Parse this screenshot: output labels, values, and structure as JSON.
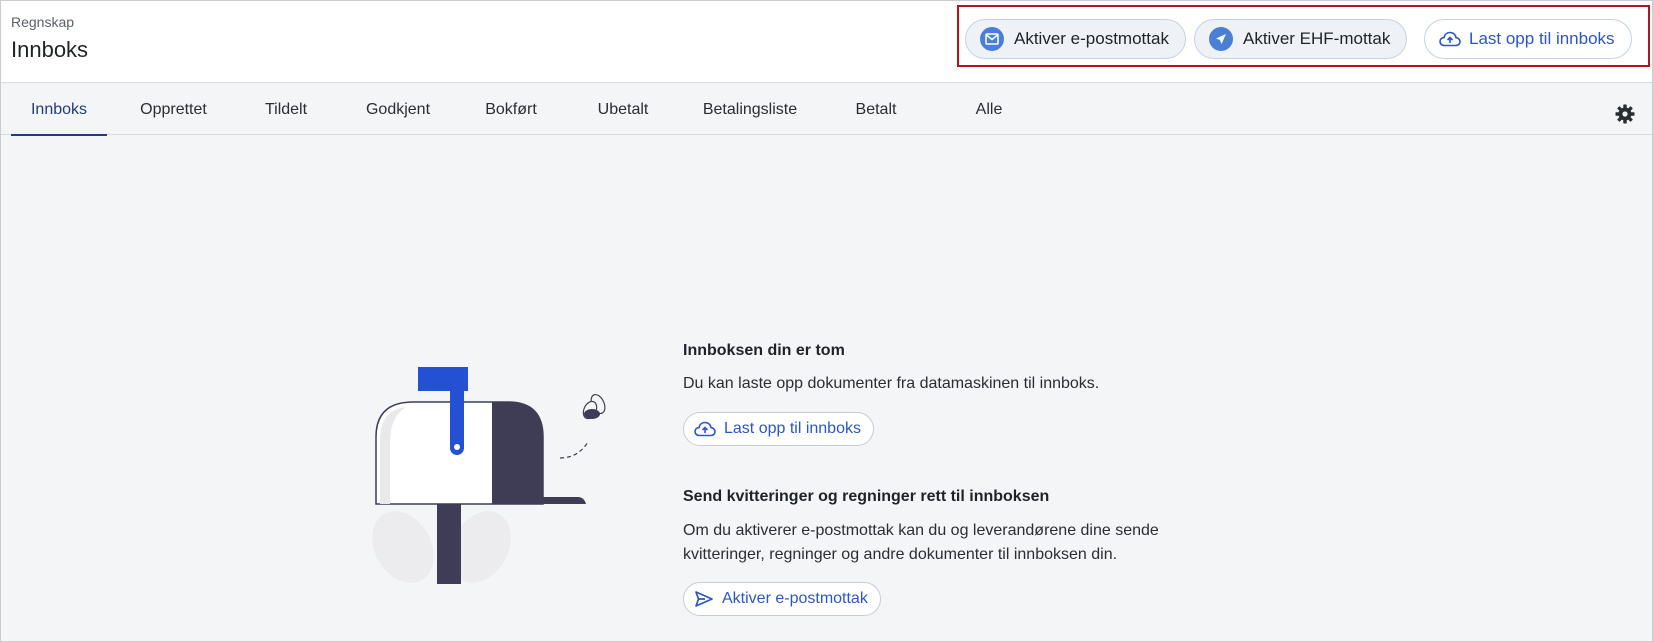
{
  "header": {
    "breadcrumb": "Regnskap",
    "title": "Innboks",
    "actions": {
      "email_label": "Aktiver e-postmottak",
      "ehf_label": "Aktiver EHF-mottak",
      "upload_label": "Last opp til innboks"
    }
  },
  "tabs": [
    {
      "label": "Innboks",
      "active": true
    },
    {
      "label": "Opprettet"
    },
    {
      "label": "Tildelt"
    },
    {
      "label": "Godkjent"
    },
    {
      "label": "Bokført"
    },
    {
      "label": "Ubetalt"
    },
    {
      "label": "Betalingsliste"
    },
    {
      "label": "Betalt"
    },
    {
      "label": "Alle"
    }
  ],
  "empty_state": {
    "title": "Innboksen din er tom",
    "text": "Du kan laste opp dokumenter fra datamaskinen til innboks.",
    "upload_label": "Last opp til innboks",
    "send_title": "Send kvitteringer og regninger rett til innboksen",
    "send_text": "Om du aktiverer e-postmottak kan du og leverandørene dine sende kvitteringer, regninger og andre dokumenter til innboksen din.",
    "activate_label": "Aktiver e-postmottak"
  },
  "icons": {
    "email": "email-icon",
    "ehf": "send-icon",
    "upload": "cloud-upload-icon",
    "settings": "gear-icon"
  },
  "colors": {
    "accent": "#2b56c5",
    "active_tab": "#1f3e7a",
    "highlight_border": "#b3121f"
  }
}
